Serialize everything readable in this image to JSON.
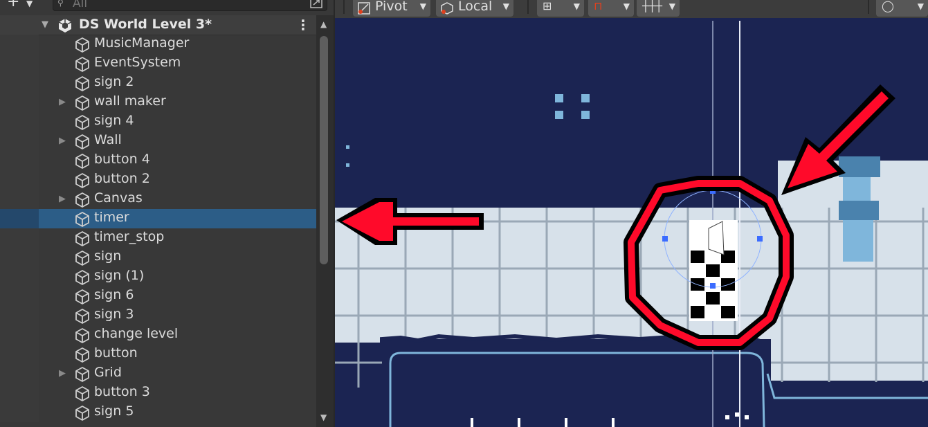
{
  "hierarchy": {
    "add_icon": "plus-icon",
    "search": {
      "value": "",
      "placeholder": "All"
    },
    "scene": {
      "title": "DS World Level 3*"
    },
    "items": [
      {
        "label": "MusicManager",
        "expandable": false,
        "selected": false
      },
      {
        "label": "EventSystem",
        "expandable": false,
        "selected": false
      },
      {
        "label": "sign 2",
        "expandable": false,
        "selected": false
      },
      {
        "label": "wall maker",
        "expandable": true,
        "selected": false
      },
      {
        "label": "sign 4",
        "expandable": false,
        "selected": false
      },
      {
        "label": "Wall",
        "expandable": true,
        "selected": false
      },
      {
        "label": "button 4",
        "expandable": false,
        "selected": false
      },
      {
        "label": "button 2",
        "expandable": false,
        "selected": false
      },
      {
        "label": "Canvas",
        "expandable": true,
        "selected": false
      },
      {
        "label": "timer",
        "expandable": false,
        "selected": true
      },
      {
        "label": "timer_stop",
        "expandable": false,
        "selected": false
      },
      {
        "label": "sign",
        "expandable": false,
        "selected": false
      },
      {
        "label": "sign (1)",
        "expandable": false,
        "selected": false
      },
      {
        "label": "sign 6",
        "expandable": false,
        "selected": false
      },
      {
        "label": "sign 3",
        "expandable": false,
        "selected": false
      },
      {
        "label": "change level",
        "expandable": false,
        "selected": false
      },
      {
        "label": "button",
        "expandable": false,
        "selected": false
      },
      {
        "label": "Grid",
        "expandable": true,
        "selected": false
      },
      {
        "label": "button 3",
        "expandable": false,
        "selected": false
      },
      {
        "label": "sign 5",
        "expandable": false,
        "selected": false
      }
    ]
  },
  "scene_toolbar": {
    "pivot_label": "Pivot",
    "local_label": "Local"
  },
  "colors": {
    "selection": "#2c5d87",
    "scene_bg": "#1b2452",
    "tile": "#d7e1ea",
    "annotation_red": "#ff0a2a"
  }
}
